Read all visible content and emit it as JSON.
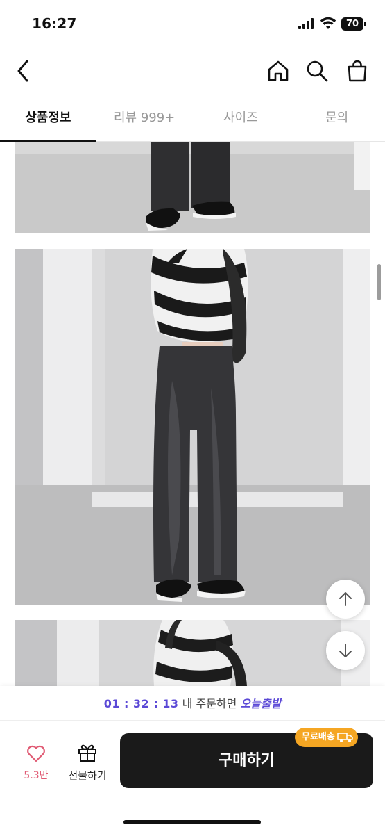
{
  "status_bar": {
    "time": "16:27",
    "battery": "70"
  },
  "nav": {
    "back_icon": "chevron-left-icon",
    "home_icon": "home-icon",
    "search_icon": "search-icon",
    "cart_icon": "shopping-bag-icon"
  },
  "tabs": [
    {
      "label": "상품정보",
      "active": true
    },
    {
      "label": "리뷰 999+",
      "active": false
    },
    {
      "label": "사이즈",
      "active": false
    },
    {
      "label": "문의",
      "active": false
    }
  ],
  "floating": {
    "up_icon": "arrow-up-icon",
    "down_icon": "arrow-down-icon"
  },
  "promo": {
    "timer": "01 : 32 : 13",
    "text": " 내 주문하면 ",
    "highlight": "오늘출발"
  },
  "bottom": {
    "like_count": "5.3만",
    "gift_label": "선물하기",
    "buy_label": "구매하기",
    "shipping_badge": "무료배송"
  },
  "colors": {
    "accent_purple": "#5b49d6",
    "like_pink": "#e05a73",
    "badge_orange": "#f5a623",
    "buy_dark": "#1a1a1a"
  }
}
